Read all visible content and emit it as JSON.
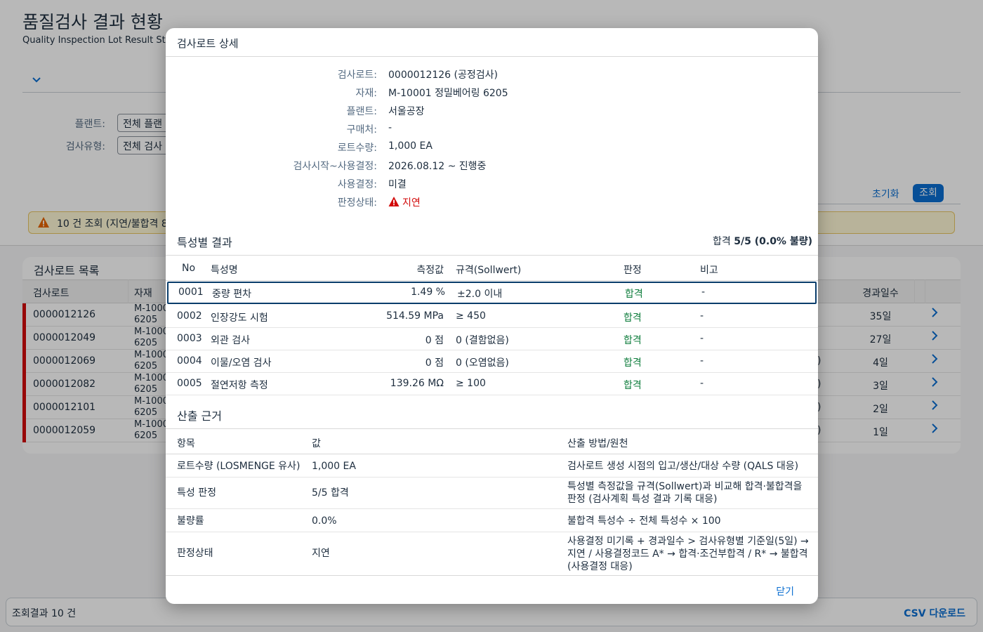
{
  "page": {
    "title": "품질검사 결과 현황",
    "subtitle": "Quality Inspection Lot Result Stat",
    "filters": [
      {
        "label": "플랜트:",
        "value": "전체 플랜"
      },
      {
        "label": "검사유형:",
        "value": "전체 검사"
      }
    ],
    "reset_label": "초기화",
    "search_label": "조회",
    "message": "10 건 조회 (지연/불합격 8",
    "table_title": "검사로트 목록",
    "columns": {
      "lot": "검사로트",
      "material": "자재",
      "days": "경과일수"
    },
    "rows": [
      {
        "lot": "0000012126",
        "material": "M-1000 6205",
        "paren": "",
        "days": "35일"
      },
      {
        "lot": "0000012049",
        "material": "M-1000 6205",
        "paren": "",
        "days": "27일"
      },
      {
        "lot": "0000012069",
        "material": "M-1000 6205",
        "paren": ")",
        "days": "4일"
      },
      {
        "lot": "0000012082",
        "material": "M-1000 6205",
        "paren": ")",
        "days": "3일"
      },
      {
        "lot": "0000012101",
        "material": "M-1000 6205",
        "paren": ")",
        "days": "2일"
      },
      {
        "lot": "0000012059",
        "material": "M-1000 6205",
        "paren": ")",
        "days": "1일"
      }
    ],
    "footer_count": "조회결과 10 건",
    "csv_label": "CSV 다운로드"
  },
  "dialog": {
    "title": "검사로트 상세",
    "details": [
      {
        "label": "검사로트:",
        "value": "0000012126 (공정검사)"
      },
      {
        "label": "자재:",
        "value": "M-10001 정밀베어링 6205"
      },
      {
        "label": "플랜트:",
        "value": "서울공장"
      },
      {
        "label": "구매처:",
        "value": "-"
      },
      {
        "label": "로트수량:",
        "value": "1,000 EA"
      },
      {
        "label": "검사시작~사용결정:",
        "value": "2026.08.12 ~ 진행중"
      },
      {
        "label": "사용결정:",
        "value": "미결"
      },
      {
        "label": "판정상태:",
        "value": "지연"
      }
    ],
    "char_section": {
      "title": "특성별 결과",
      "summary_prefix": "합격 ",
      "summary_bold": "5/5 (0.0% 불량)",
      "headers": {
        "no": "No",
        "name": "특성명",
        "measured": "측정값",
        "spec": "규격(Sollwert)",
        "judgement": "판정",
        "remark": "비고"
      },
      "rows": [
        {
          "no": "0001",
          "name": "중량 편차",
          "measured": "1.49 %",
          "spec": "±2.0 이내",
          "judgement": "합격",
          "remark": "-"
        },
        {
          "no": "0002",
          "name": "인장강도 시험",
          "measured": "514.59 MPa",
          "spec": "≥ 450",
          "judgement": "합격",
          "remark": "-"
        },
        {
          "no": "0003",
          "name": "외관 검사",
          "measured": "0 점",
          "spec": "0 (결함없음)",
          "judgement": "합격",
          "remark": "-"
        },
        {
          "no": "0004",
          "name": "이물/오염 검사",
          "measured": "0 점",
          "spec": "0 (오염없음)",
          "judgement": "합격",
          "remark": "-"
        },
        {
          "no": "0005",
          "name": "절연저항 측정",
          "measured": "139.26 MΩ",
          "spec": "≥ 100",
          "judgement": "합격",
          "remark": "-"
        }
      ]
    },
    "basis_section": {
      "title": "산출 근거",
      "headers": {
        "item": "항목",
        "value": "값",
        "method": "산출 방법/원천"
      },
      "rows": [
        {
          "item": "로트수량 (LOSMENGE 유사)",
          "value": "1,000 EA",
          "method": "검사로트 생성 시점의 입고/생산/대상 수량 (QALS 대응)"
        },
        {
          "item": "특성 판정",
          "value": "5/5 합격",
          "method": "특성별 측정값을 규격(Sollwert)과 비교해 합격·불합격을 판정 (검사계획 특성 결과 기록 대응)"
        },
        {
          "item": "불량률",
          "value": "0.0%",
          "method": "불합격 특성수 ÷ 전체 특성수 × 100"
        },
        {
          "item": "판정상태",
          "value": "지연",
          "method": "사용결정 미기록 + 경과일수 > 검사유형별 기준일(5일) → 지연 / 사용결정코드 A* → 합격·조건부합격 / R* → 불합격 (사용결정 대응)"
        }
      ]
    },
    "close_label": "닫기"
  },
  "colors": {
    "accent": "#0a6ed1",
    "error": "#d20a0a",
    "success": "#107e3e",
    "warning_bg": "#fff8d6"
  }
}
